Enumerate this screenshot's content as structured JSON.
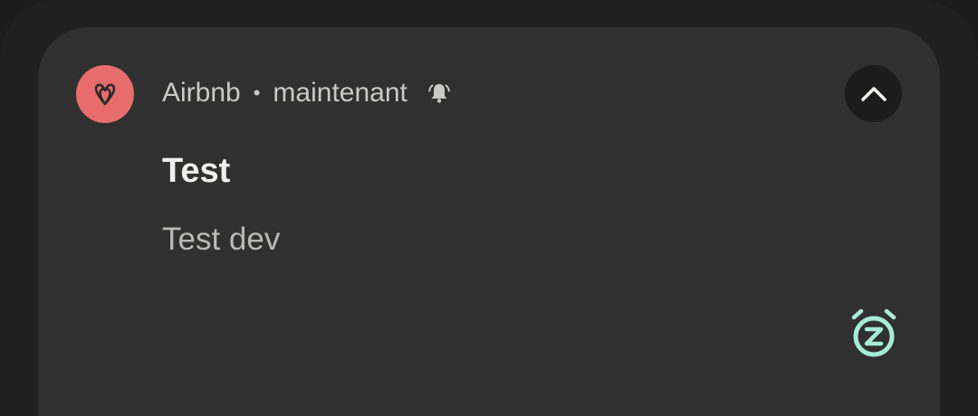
{
  "notification": {
    "app_name": "Airbnb",
    "separator": "•",
    "time": "maintenant",
    "title": "Test",
    "body": "Test dev"
  },
  "icons": {
    "app": "airbnb-logo-icon",
    "alert": "bell-ringing-icon",
    "expand": "chevron-up-icon",
    "snooze": "snooze-alarm-icon"
  },
  "colors": {
    "app_icon_bg": "#e86c6c",
    "card_bg": "#2f302f",
    "snooze_accent": "#a8ead8"
  }
}
